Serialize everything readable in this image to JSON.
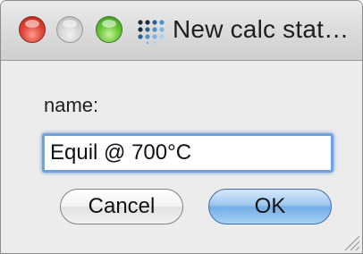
{
  "window": {
    "title": "New calc stat…"
  },
  "form": {
    "name_label": "name:",
    "name_value": "Equil @ 700°C"
  },
  "buttons": {
    "cancel_label": "Cancel",
    "ok_label": "OK"
  },
  "icons": {
    "close": "close-button",
    "minimize": "minimize-button",
    "zoom": "zoom-button",
    "app": "app-dot-grid-icon",
    "resize": "resize-grip-icon"
  },
  "colors": {
    "focus_ring": "#6fa2dc",
    "default_button": "#72aee6",
    "close": "#e24a3c",
    "zoom": "#6cc93b"
  }
}
